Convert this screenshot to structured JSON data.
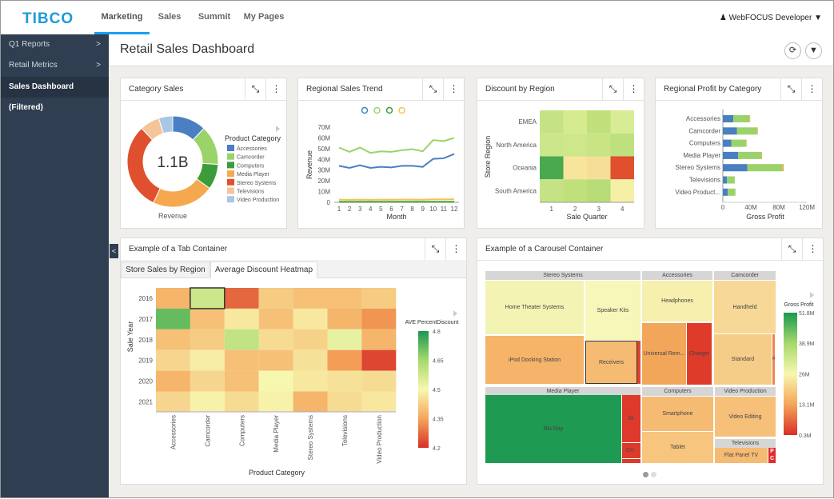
{
  "header": {
    "logo": "TIBCO",
    "nav": [
      "Marketing",
      "Sales",
      "Summit",
      "My Pages"
    ],
    "active_nav": "Marketing",
    "user": "WebFOCUS Developer"
  },
  "sidebar": {
    "items": [
      {
        "label": "Q1 Reports",
        "chevron": ">"
      },
      {
        "label": "Retail Metrics",
        "chevron": ">"
      },
      {
        "label": "Sales Dashboard (Filtered)"
      }
    ]
  },
  "page": {
    "title": "Retail Sales Dashboard",
    "icons": [
      "refresh-icon",
      "filter-icon"
    ]
  },
  "panels": {
    "category_sales": "Category Sales",
    "regional_trend": "Regional Sales Trend",
    "discount_region": "Discount by Region",
    "regional_profit": "Regional Profit by Category",
    "tab_container": "Example of a Tab Container",
    "carousel": "Example of a Carousel Container"
  },
  "tabs": [
    "Store Sales by Region",
    "Average Discount Heatmap"
  ],
  "active_tab": "Average Discount Heatmap",
  "chart_data": [
    {
      "type": "pie",
      "title": "",
      "center_label": "1.1B",
      "xlabel": "Revenue",
      "legend_title": "Product Category",
      "legend_placement": "right",
      "categories": [
        "Accessories",
        "Camcorder",
        "Computers",
        "Media Player",
        "Stereo Systems",
        "Televisions",
        "Video Production"
      ],
      "values": [
        12,
        14,
        9,
        22,
        31,
        7,
        5
      ],
      "colors": [
        "#4a7fc1",
        "#9ad36a",
        "#3d9c3a",
        "#f6a84e",
        "#e0502e",
        "#f4c59a",
        "#a9c6e6"
      ]
    },
    {
      "type": "line",
      "xlabel": "Month",
      "ylabel": "Revenue",
      "ylim": [
        0,
        70
      ],
      "yticks": [
        "0",
        "10M",
        "20M",
        "30M",
        "40M",
        "50M",
        "60M",
        "70M"
      ],
      "x": [
        1,
        2,
        3,
        4,
        5,
        6,
        7,
        8,
        9,
        10,
        11,
        12
      ],
      "series": [
        {
          "color": "#4a7fc1",
          "values": [
            34,
            32,
            34.5,
            32,
            33,
            32.5,
            34,
            34,
            33,
            40.5,
            41,
            45
          ]
        },
        {
          "color": "#9ad36a",
          "values": [
            51,
            47,
            51,
            46,
            47.5,
            47,
            48.5,
            49.5,
            47.5,
            58,
            57,
            60
          ]
        },
        {
          "color": "#3d9c3a",
          "values": [
            0.5,
            0.5,
            0.5,
            0.5,
            0.5,
            0.5,
            0.5,
            0.5,
            0.5,
            0.5,
            0.5,
            0.5
          ]
        },
        {
          "color": "#f6c44e",
          "values": [
            2.5,
            2.3,
            2.5,
            2.3,
            2.5,
            2.4,
            2.5,
            2.5,
            2.4,
            2.8,
            2.8,
            2.9
          ]
        }
      ]
    },
    {
      "type": "heatmap",
      "xlabel": "Sale Quarter",
      "ylabel": "Store Region",
      "x": [
        "1",
        "2",
        "3",
        "4"
      ],
      "y": [
        "EMEA",
        "North America",
        "Oceania",
        "South America"
      ],
      "cell_colors": [
        [
          "#c5e384",
          "#d5eb8e",
          "#c0e07c",
          "#d7ec95"
        ],
        [
          "#cce68a",
          "#cfe78b",
          "#c8e485",
          "#bfe07e"
        ],
        [
          "#4aa94f",
          "#f7e59c",
          "#f5de98",
          "#e04f2e"
        ],
        [
          "#c5e384",
          "#c0e07c",
          "#b8dc77",
          "#f5f0a6"
        ]
      ]
    },
    {
      "type": "bar",
      "orientation": "horizontal",
      "stacked": true,
      "xlabel": "Gross Profit",
      "xlim": [
        0,
        120
      ],
      "xticks": [
        "0",
        "40M",
        "80M",
        "120M"
      ],
      "categories": [
        "Accessories",
        "Camcorder",
        "Computers",
        "Media Player",
        "Stereo Systems",
        "Televisions",
        "Video Product..."
      ],
      "series": [
        {
          "color": "#4a7fc1",
          "values": [
            15,
            20,
            12,
            22,
            35,
            6,
            7
          ]
        },
        {
          "color": "#9ad36a",
          "values": [
            23,
            29,
            21,
            33,
            50,
            11,
            11
          ]
        },
        {
          "color": "#f6a84e",
          "values": [
            1,
            1,
            1,
            1,
            2,
            0,
            0
          ]
        }
      ]
    },
    {
      "type": "heatmap",
      "xlabel": "Product Category",
      "ylabel": "Sale Year",
      "legend_title": "AVE PercentDiscount",
      "scale": [
        4.2,
        4.8
      ],
      "scale_ticks": [
        "4.8",
        "4.65",
        "4.5",
        "4.35",
        "4.2"
      ],
      "x": [
        "Accessories",
        "Camcorder",
        "Computers",
        "Media Player",
        "Stereo Systems",
        "Televisions",
        "Video Production"
      ],
      "y": [
        "2016",
        "2017",
        "2018",
        "2019",
        "2020",
        "2021"
      ],
      "values": [
        [
          4.38,
          4.58,
          4.27,
          4.42,
          4.4,
          4.4,
          4.42
        ],
        [
          4.72,
          4.4,
          4.47,
          4.4,
          4.47,
          4.38,
          4.33
        ],
        [
          4.4,
          4.42,
          4.6,
          4.45,
          4.43,
          4.53,
          4.38
        ],
        [
          4.44,
          4.48,
          4.4,
          4.4,
          4.46,
          4.34,
          4.23
        ],
        [
          4.38,
          4.44,
          4.4,
          4.5,
          4.47,
          4.46,
          4.45
        ],
        [
          4.44,
          4.49,
          4.45,
          4.49,
          4.38,
          4.45,
          4.47
        ]
      ]
    },
    {
      "type": "treemap",
      "legend_title": "Gross Profit",
      "scale_ticks": [
        "51.8M",
        "38.9M",
        "26M",
        "13.1M",
        "0.3M"
      ],
      "groups": [
        "Stereo Systems",
        "Accessories",
        "Camcorder",
        "Media Player",
        "Computers",
        "Video Production",
        "Televisions"
      ],
      "cells": [
        {
          "label": "Home Theater Systems",
          "color": "#f3f3b4"
        },
        {
          "label": "Speaker Kits",
          "color": "#f6f7b8"
        },
        {
          "label": "iPod Docking Station",
          "color": "#f5b46a"
        },
        {
          "label": "Receivers",
          "color": "#f5bb72"
        },
        {
          "label": "",
          "color": "#e0452c"
        },
        {
          "label": "Headphones",
          "color": "#f6efae"
        },
        {
          "label": "Universal Rem...",
          "color": "#f2a65a"
        },
        {
          "label": "Charger",
          "color": "#df3b2b"
        },
        {
          "label": "Handheld",
          "color": "#f7d897"
        },
        {
          "label": "Standard",
          "color": "#f6cd88"
        },
        {
          "label": "P",
          "color": "#ef8550"
        },
        {
          "label": "Blu Ray",
          "color": "#1e9a52"
        },
        {
          "label": "St.",
          "color": "#dd3a2c"
        },
        {
          "label": "DV..",
          "color": "#dd3a2c"
        },
        {
          "label": "",
          "color": "#dd3a2c"
        },
        {
          "label": "Smartphone",
          "color": "#f6bb72"
        },
        {
          "label": "Tablet",
          "color": "#f7c57e"
        },
        {
          "label": "Video Editing",
          "color": "#f6c07a"
        },
        {
          "label": "Flat Panel TV",
          "color": "#f6bb72"
        },
        {
          "label": "P",
          "color": "#e02d2a"
        },
        {
          "label": "C",
          "color": "#e02d2a"
        }
      ]
    }
  ]
}
